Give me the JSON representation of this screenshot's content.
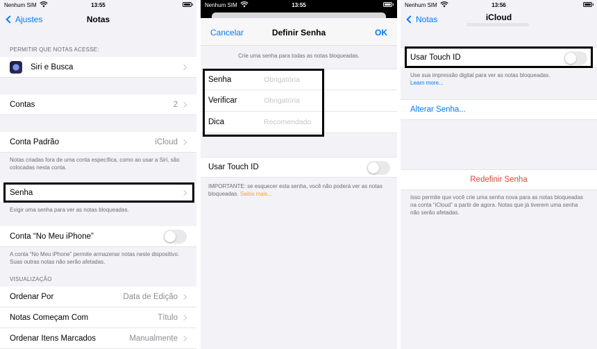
{
  "status": {
    "carrier": "Nenhum SIM",
    "time_1": "13:55",
    "time_2": "13:55",
    "time_3": "13:56"
  },
  "panel1": {
    "back_label": "Ajustes",
    "title": "Notas",
    "section_access_header": "PERMITIR QUE NOTAS ACESSE:",
    "siri_label": "Siri e Busca",
    "accounts_label": "Contas",
    "accounts_value": "2",
    "default_account_label": "Conta Padrão",
    "default_account_value": "iCloud",
    "default_account_footer": "Notas criadas fora de uma conta específica, como ao usar a Siri, são colocadas nesta conta.",
    "password_label": "Senha",
    "password_footer": "Exigir uma senha para ver as notas bloqueadas.",
    "on_my_iphone_label": "Conta “No Meu iPhone”",
    "on_my_iphone_footer": "A conta “No Meu iPhone” permite armazenar notas neste dispositivo. Suas outras notas não serão afetadas.",
    "view_header": "VISUALIZAÇÃO",
    "sort_by_label": "Ordenar Por",
    "sort_by_value": "Data de Edição",
    "notes_start_label": "Notas Começam Com",
    "notes_start_value": "Título",
    "sort_checked_label": "Ordenar Itens Marcados",
    "sort_checked_value": "Manualmente"
  },
  "panel2": {
    "cancel_label": "Cancelar",
    "title": "Definir Senha",
    "ok_label": "OK",
    "intro": "Crie uma senha para todas as notas bloqueadas.",
    "password_label": "Senha",
    "password_placeholder": "Obrigatória",
    "verify_label": "Verificar",
    "verify_placeholder": "Obrigatória",
    "hint_label": "Dica",
    "hint_placeholder": "Recomendado",
    "touch_id_label": "Usar Touch ID",
    "important_text": "IMPORTANTE: se esquecer esta senha, você não poderá ver as notas bloqueadas.",
    "learn_more": "Saiba mais..."
  },
  "panel3": {
    "back_label": "Notas",
    "title": "iCloud",
    "touch_id_label": "Usar Touch ID",
    "touch_id_footer": "Use sua impressão digital para ver as notas bloqueadas.",
    "learn_more": "Learn more...",
    "change_password": "Alterar Senha...",
    "reset_password": "Redefinir Senha",
    "reset_footer": "Isso permite que você crie uma senha nova para as notas bloqueadas na conta “iCloud” a partir de agora. Notas que já tiverem uma senha não serão afetadas."
  },
  "colors": {
    "accent": "#007aff",
    "destructive": "#e0453a",
    "link_orange": "#f0a830",
    "grouped_bg": "#f2f2f7"
  }
}
